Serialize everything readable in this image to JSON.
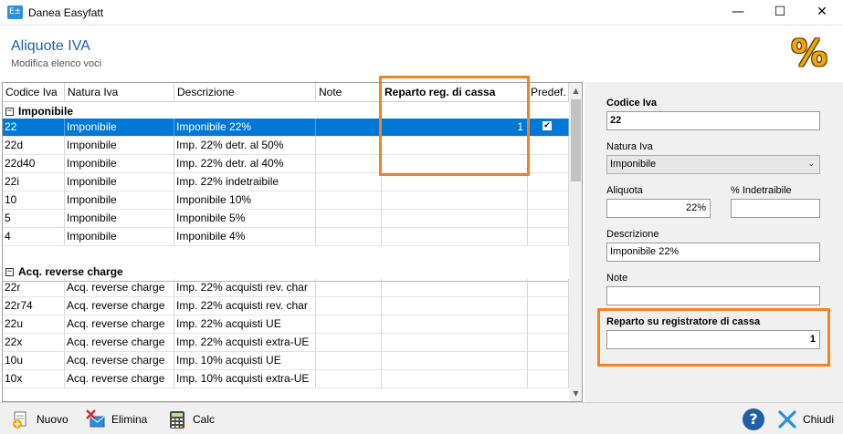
{
  "window": {
    "icon_text": "E±",
    "title": "Danea Easyfatt",
    "minimize": "—",
    "maximize": "☐",
    "close": "✕"
  },
  "header": {
    "title": "Aliquote IVA",
    "subtitle": "Modifica elenco voci",
    "icon_glyph": "%"
  },
  "grid": {
    "columns": [
      "Codice Iva",
      "Natura Iva",
      "Descrizione",
      "Note",
      "Reparto reg. di cassa",
      "Predef."
    ],
    "groups": [
      {
        "toggle": "−",
        "label": "Imponibile",
        "rows": [
          {
            "codice": "22",
            "natura": "Imponibile",
            "descrizione": "Imponibile 22%",
            "note": "",
            "reparto": "1",
            "predef": true
          },
          {
            "codice": "22d",
            "natura": "Imponibile",
            "descrizione": "Imp. 22% detr. al 50%",
            "note": "",
            "reparto": "",
            "predef": false
          },
          {
            "codice": "22d40",
            "natura": "Imponibile",
            "descrizione": "Imp. 22% detr. al 40%",
            "note": "",
            "reparto": "",
            "predef": false
          },
          {
            "codice": "22i",
            "natura": "Imponibile",
            "descrizione": "Imp. 22% indetraibile",
            "note": "",
            "reparto": "",
            "predef": false
          },
          {
            "codice": "10",
            "natura": "Imponibile",
            "descrizione": "Imponibile 10%",
            "note": "",
            "reparto": "",
            "predef": false
          },
          {
            "codice": "5",
            "natura": "Imponibile",
            "descrizione": "Imponibile 5%",
            "note": "",
            "reparto": "",
            "predef": false
          },
          {
            "codice": "4",
            "natura": "Imponibile",
            "descrizione": "Imponibile 4%",
            "note": "",
            "reparto": "",
            "predef": false
          }
        ]
      },
      {
        "toggle": "−",
        "label": "Acq. reverse charge",
        "rows": [
          {
            "codice": "22r",
            "natura": "Acq. reverse charge",
            "descrizione": "Imp. 22% acquisti rev. char",
            "note": "",
            "reparto": "",
            "predef": false
          },
          {
            "codice": "22r74",
            "natura": "Acq. reverse charge",
            "descrizione": "Imp. 22% acquisti rev. char",
            "note": "",
            "reparto": "",
            "predef": false
          },
          {
            "codice": "22u",
            "natura": "Acq. reverse charge",
            "descrizione": "Imp. 22% acquisti UE",
            "note": "",
            "reparto": "",
            "predef": false
          },
          {
            "codice": "22x",
            "natura": "Acq. reverse charge",
            "descrizione": "Imp. 22% acquisti extra-UE",
            "note": "",
            "reparto": "",
            "predef": false
          },
          {
            "codice": "10u",
            "natura": "Acq. reverse charge",
            "descrizione": "Imp. 10% acquisti UE",
            "note": "",
            "reparto": "",
            "predef": false
          },
          {
            "codice": "10x",
            "natura": "Acq. reverse charge",
            "descrizione": "Imp. 10% acquisti extra-UE",
            "note": "",
            "reparto": "",
            "predef": false
          }
        ]
      }
    ],
    "check_glyph": "✔",
    "scroll_up": "▲",
    "scroll_down": "▼"
  },
  "panel": {
    "codice_label": "Codice Iva",
    "codice_value": "22",
    "natura_label": "Natura Iva",
    "natura_value": "Imponibile",
    "chevron": "⌄",
    "aliquota_label": "Aliquota",
    "aliquota_value": "22%",
    "indetraibile_label": "% Indetraibile",
    "indetraibile_value": "",
    "descrizione_label": "Descrizione",
    "descrizione_value": "Imponibile 22%",
    "note_label": "Note",
    "note_value": "",
    "reparto_label": "Reparto su registratore di cassa",
    "reparto_value": "1"
  },
  "toolbar": {
    "nuovo": "Nuovo",
    "elimina": "Elimina",
    "calc": "Calc",
    "help": "?",
    "chiudi": "Chiudi"
  },
  "colors": {
    "accent": "#0078d7",
    "highlight": "#f58220",
    "title": "#1f5fa8"
  }
}
